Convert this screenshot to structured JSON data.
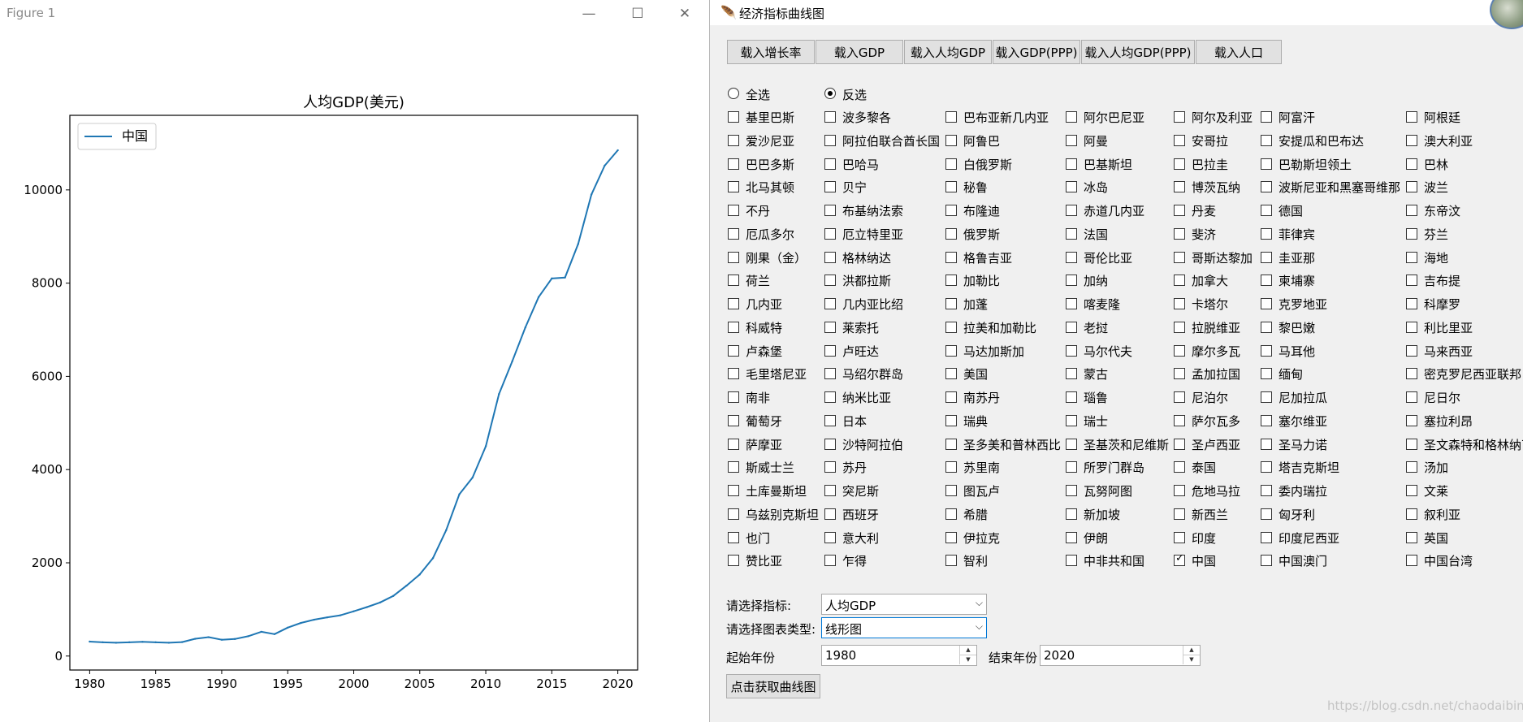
{
  "figure": {
    "title": "Figure 1",
    "controls": {
      "minimize": "—",
      "maximize": "☐",
      "close": "✕"
    }
  },
  "chart_data": {
    "type": "line",
    "title": "人均GDP(美元)",
    "xlabel": "",
    "ylabel": "",
    "xlim": [
      1978.5,
      2021.5
    ],
    "ylim": [
      -300,
      11600
    ],
    "xticks": [
      1980,
      1985,
      1990,
      1995,
      2000,
      2005,
      2010,
      2015,
      2020
    ],
    "yticks": [
      0,
      2000,
      4000,
      6000,
      8000,
      10000
    ],
    "grid": false,
    "legend": "upper left",
    "series": [
      {
        "name": "中国",
        "color": "#1f77b4",
        "x": [
          1980,
          1981,
          1982,
          1983,
          1984,
          1985,
          1986,
          1987,
          1988,
          1989,
          1990,
          1991,
          1992,
          1993,
          1994,
          1995,
          1996,
          1997,
          1998,
          1999,
          2000,
          2001,
          2002,
          2003,
          2004,
          2005,
          2006,
          2007,
          2008,
          2009,
          2010,
          2011,
          2012,
          2013,
          2014,
          2015,
          2016,
          2017,
          2018,
          2019,
          2020
        ],
        "y": [
          310,
          295,
          285,
          295,
          305,
          295,
          285,
          300,
          370,
          405,
          350,
          365,
          425,
          520,
          470,
          610,
          710,
          780,
          830,
          875,
          960,
          1050,
          1150,
          1290,
          1510,
          1750,
          2100,
          2700,
          3470,
          3830,
          4500,
          5620,
          6320,
          7050,
          7700,
          8100,
          8120,
          8840,
          9900,
          10520,
          10850
        ]
      }
    ]
  },
  "app": {
    "title": "经济指标曲线图",
    "feather_icon": "🪶",
    "load_buttons": [
      "载入增长率",
      "载入GDP",
      "载入人均GDP",
      "载入GDP(PPP)",
      "载入人均GDP(PPP)",
      "载入人口"
    ],
    "radios": [
      {
        "label": "全选",
        "selected": false
      },
      {
        "label": "反选",
        "selected": true
      }
    ],
    "countries": [
      [
        "基里巴斯",
        "波多黎各",
        "巴布亚新几内亚",
        "阿尔巴尼亚",
        "阿尔及利亚",
        "阿富汗",
        "阿根廷"
      ],
      [
        "爱沙尼亚",
        "阿拉伯联合酋长国",
        "阿鲁巴",
        "阿曼",
        "安哥拉",
        "安提瓜和巴布达",
        "澳大利亚"
      ],
      [
        "巴巴多斯",
        "巴哈马",
        "白俄罗斯",
        "巴基斯坦",
        "巴拉圭",
        "巴勒斯坦领土",
        "巴林"
      ],
      [
        "北马其顿",
        "贝宁",
        "秘鲁",
        "冰岛",
        "博茨瓦纳",
        "波斯尼亚和黑塞哥维那",
        "波兰"
      ],
      [
        "不丹",
        "布基纳法索",
        "布隆迪",
        "赤道几内亚",
        "丹麦",
        "德国",
        "东帝汶"
      ],
      [
        "厄瓜多尔",
        "厄立特里亚",
        "俄罗斯",
        "法国",
        "斐济",
        "菲律宾",
        "芬兰"
      ],
      [
        "刚果（金）",
        "格林纳达",
        "格鲁吉亚",
        "哥伦比亚",
        "哥斯达黎加",
        "圭亚那",
        "海地"
      ],
      [
        "荷兰",
        "洪都拉斯",
        "加勒比",
        "加纳",
        "加拿大",
        "柬埔寨",
        "吉布提"
      ],
      [
        "几内亚",
        "几内亚比绍",
        "加蓬",
        "喀麦隆",
        "卡塔尔",
        "克罗地亚",
        "科摩罗"
      ],
      [
        "科威特",
        "莱索托",
        "拉美和加勒比",
        "老挝",
        "拉脱维亚",
        "黎巴嫩",
        "利比里亚"
      ],
      [
        "卢森堡",
        "卢旺达",
        "马达加斯加",
        "马尔代夫",
        "摩尔多瓦",
        "马耳他",
        "马来西亚"
      ],
      [
        "毛里塔尼亚",
        "马绍尔群岛",
        "美国",
        "蒙古",
        "孟加拉国",
        "缅甸",
        "密克罗尼西亚联邦"
      ],
      [
        "南非",
        "纳米比亚",
        "南苏丹",
        "瑙鲁",
        "尼泊尔",
        "尼加拉瓜",
        "尼日尔"
      ],
      [
        "葡萄牙",
        "日本",
        "瑞典",
        "瑞士",
        "萨尔瓦多",
        "塞尔维亚",
        "塞拉利昂"
      ],
      [
        "萨摩亚",
        "沙特阿拉伯",
        "圣多美和普林西比",
        "圣基茨和尼维斯",
        "圣卢西亚",
        "圣马力诺",
        "圣文森特和格林纳丁"
      ],
      [
        "斯威士兰",
        "苏丹",
        "苏里南",
        "所罗门群岛",
        "泰国",
        "塔吉克斯坦",
        "汤加"
      ],
      [
        "土库曼斯坦",
        "突尼斯",
        "图瓦卢",
        "瓦努阿图",
        "危地马拉",
        "委内瑞拉",
        "文莱"
      ],
      [
        "乌兹别克斯坦",
        "西班牙",
        "希腊",
        "新加坡",
        "新西兰",
        "匈牙利",
        "叙利亚"
      ],
      [
        "也门",
        "意大利",
        "伊拉克",
        "伊朗",
        "印度",
        "印度尼西亚",
        "英国"
      ],
      [
        "赞比亚",
        "乍得",
        "智利",
        "中非共和国",
        "中国",
        "中国澳门",
        "中国台湾"
      ]
    ],
    "checked": [
      "中国"
    ],
    "indicator_label": "请选择指标:",
    "indicator_value": "人均GDP",
    "chart_type_label": "请选择图表类型:",
    "chart_type_value": "线形图",
    "start_year_label": "起始年份",
    "start_year": "1980",
    "end_year_label": "结束年份",
    "end_year": "2020",
    "get_button": "点击获取曲线图",
    "watermark": "https://blog.csdn.net/chaodaibing"
  }
}
